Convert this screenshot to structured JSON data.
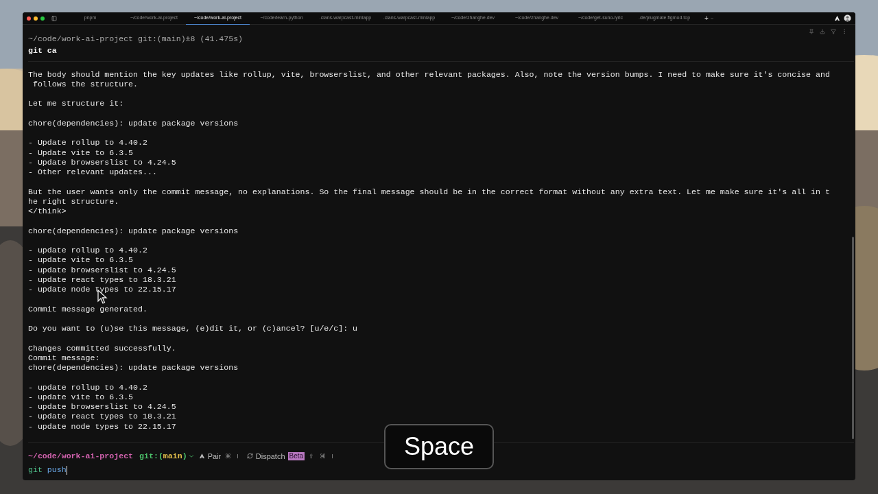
{
  "tabs": [
    {
      "label": "pnpm",
      "selected": false
    },
    {
      "label": "~/code/work-ai-project",
      "selected": false
    },
    {
      "label": "~/code/work-ai-project",
      "selected": true
    },
    {
      "label": "~/code/learn-python",
      "selected": false
    },
    {
      "label": ".cians-warpcast-miniapp",
      "selected": false
    },
    {
      "label": ".cians-warpcast-miniapp",
      "selected": false
    },
    {
      "label": "~/code/zhanghe.dev",
      "selected": false
    },
    {
      "label": "~/code/zhanghe.dev",
      "selected": false
    },
    {
      "label": "~/code/get-suno-lyric",
      "selected": false
    },
    {
      "label": ".de/plugmate.figmod.top",
      "selected": false
    }
  ],
  "new_tab": "+",
  "command_block": {
    "prompt": "~/code/work-ai-project git:(main)±8 (41.475s)",
    "command": "git ca"
  },
  "output_blocks": [
    {
      "lines": [
        "The body should mention the key updates like rollup, vite, browserslist, and other relevant packages. Also, note the version bumps. I need to make sure it's concise and",
        " follows the structure."
      ]
    },
    {
      "lines": [
        "Let me structure it:"
      ]
    },
    {
      "lines": [
        "chore(dependencies): update package versions"
      ]
    },
    {
      "lines": [
        "- Update rollup to 4.40.2",
        "- Update vite to 6.3.5",
        "- Update browserslist to 4.24.5",
        "- Other relevant updates..."
      ]
    },
    {
      "lines": [
        "But the user wants only the commit message, no explanations. So the final message should be in the correct format without any extra text. Let me make sure it's all in t",
        "he right structure.",
        "</think>"
      ]
    },
    {
      "lines": [
        "chore(dependencies): update package versions"
      ]
    },
    {
      "lines": [
        "- update rollup to 4.40.2",
        "- update vite to 6.3.5",
        "- update browserslist to 4.24.5",
        "- update react types to 18.3.21",
        "- update node types to 22.15.17"
      ]
    },
    {
      "lines": [
        "Commit message generated."
      ]
    },
    {
      "lines": [
        "Do you want to (u)se this message, (e)dit it, or (c)ancel? [u/e/c]: u"
      ]
    },
    {
      "lines": [
        "Changes committed successfully.",
        "Commit message:",
        "chore(dependencies): update package versions"
      ]
    },
    {
      "lines": [
        "- update rollup to 4.40.2",
        "- update vite to 6.3.5",
        "- update browserslist to 4.24.5",
        "- update react types to 18.3.21",
        "- update node types to 22.15.17"
      ]
    }
  ],
  "prompt": {
    "path": "~/code/work-ai-project",
    "git_open": "git:(",
    "branch": "main",
    "git_close": ")",
    "pair_label": "Pair",
    "pair_keys": [
      "⌘",
      "I"
    ],
    "dispatch_label": "Dispatch",
    "dispatch_badge": "Beta",
    "dispatch_keys": [
      "⇧",
      "⌘",
      "I"
    ]
  },
  "input": {
    "command": "git",
    "argument": "push"
  },
  "key_overlay": "Space"
}
